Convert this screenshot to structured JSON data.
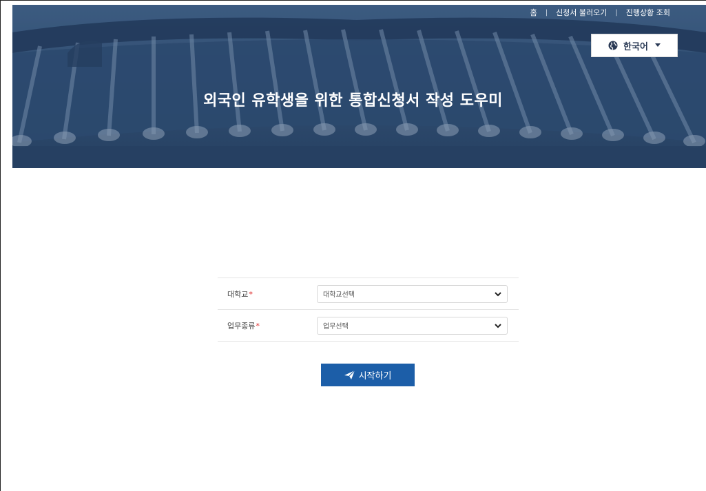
{
  "top_nav": {
    "home": "홈",
    "load_application": "신청서 불러오기",
    "progress_check": "진행상황 조회",
    "separator": "|"
  },
  "language": {
    "current": "한국어",
    "icon": "globe-icon"
  },
  "hero": {
    "title": "외국인 유학생을 위한 통합신청서 작성 도우미"
  },
  "form": {
    "university": {
      "label": "대학교",
      "required_mark": "*",
      "selected": "대학교선택"
    },
    "task_type": {
      "label": "업무종류",
      "required_mark": "*",
      "selected": "업무선택"
    }
  },
  "start_button": {
    "label": "시작하기",
    "icon": "paper-plane-icon"
  },
  "colors": {
    "hero_bg": "#2e4a6b",
    "primary_button": "#1c5ea8",
    "required": "#dd2222"
  }
}
